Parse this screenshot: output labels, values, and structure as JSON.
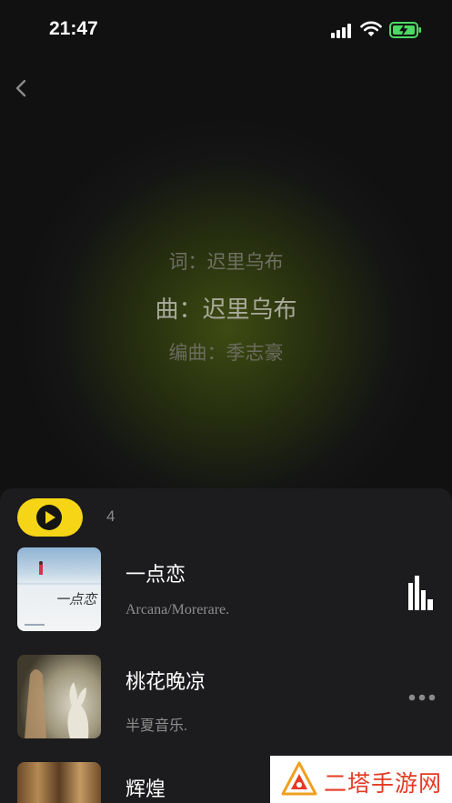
{
  "status_bar": {
    "time": "21:47"
  },
  "credits": {
    "lyricist": "词：迟里乌布",
    "composer": "曲：迟里乌布",
    "arranger": "编曲：季志豪"
  },
  "playlist": {
    "count": "4",
    "songs": [
      {
        "title": "一点恋",
        "artist": "Arcana/Morerare."
      },
      {
        "title": "桃花晚凉",
        "artist": "半夏音乐."
      },
      {
        "title": "辉煌",
        "artist": ""
      }
    ],
    "cover1_text": "一点恋"
  },
  "watermark": {
    "text": "二塔手游网"
  },
  "colors": {
    "accent": "#f5d516",
    "sheet": "#1c1c1e",
    "watermark": "#e53a24"
  }
}
